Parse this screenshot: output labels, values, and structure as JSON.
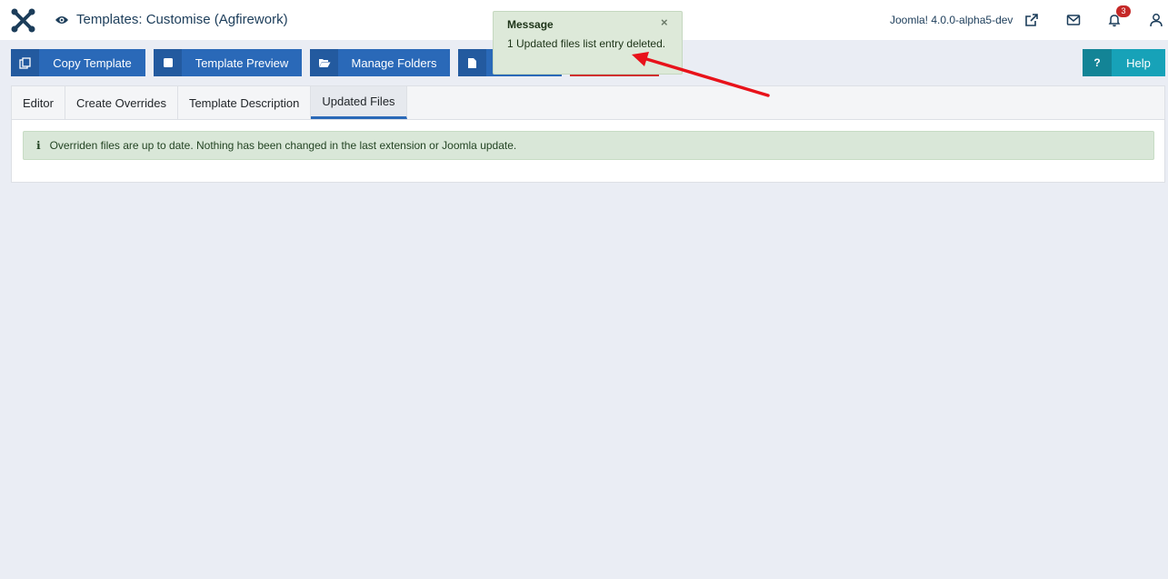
{
  "header": {
    "title": "Templates: Customise (Agfirework)",
    "version": "Joomla! 4.0.0-alpha5-dev",
    "notification_count": "3"
  },
  "toolbar": {
    "copy_label": "Copy Template",
    "preview_label": "Template Preview",
    "folders_label": "Manage Folders",
    "help_label": "Help",
    "help_icon_text": "?"
  },
  "tabs": [
    {
      "label": "Editor"
    },
    {
      "label": "Create Overrides"
    },
    {
      "label": "Template Description"
    },
    {
      "label": "Updated Files"
    }
  ],
  "alert": {
    "text": "Overriden files are up to date. Nothing has been changed in the last extension or Joomla update."
  },
  "message": {
    "title": "Message",
    "close": "×",
    "text": "1 Updated files list entry deleted."
  },
  "colors": {
    "primary": "#2a69b8",
    "danger": "#d0302f",
    "info": "#17a2b8",
    "success_bg": "#d9e7d8",
    "annotation": "#e8121a"
  }
}
